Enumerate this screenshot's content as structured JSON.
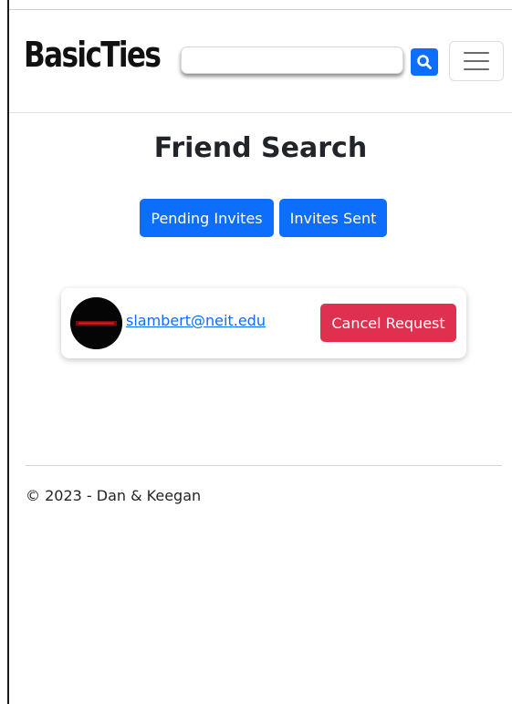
{
  "navbar": {
    "brand": "BasicTies",
    "search": {
      "value": "",
      "placeholder": "",
      "button_icon": "search-icon"
    },
    "toggler_icon": "hamburger-menu-icon"
  },
  "main": {
    "title": "Friend Search",
    "buttons": {
      "pending_invites": "Pending Invites",
      "invites_sent": "Invites Sent"
    },
    "results": [
      {
        "email": "slambert@neit.edu",
        "action_label": "Cancel Request"
      }
    ]
  },
  "footer": {
    "text": "© 2023 - Dan & Keegan"
  },
  "colors": {
    "primary": "#0d6efd",
    "danger": "#e0304f",
    "text": "#212529"
  }
}
